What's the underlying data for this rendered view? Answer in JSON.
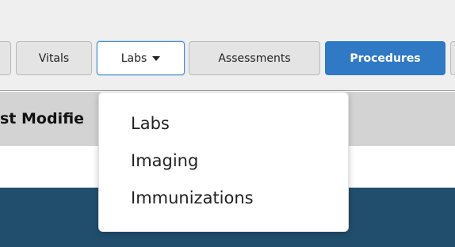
{
  "tabs": {
    "vitals": "Vitals",
    "labs": "Labs",
    "assessments": "Assessments",
    "procedures": "Procedures"
  },
  "table": {
    "column_header": "st Modifie"
  },
  "dropdown": {
    "items": [
      "Labs",
      "Imaging",
      "Immunizations"
    ]
  },
  "colors": {
    "active_tab": "#2f79c5",
    "bottom_band": "#214e6d",
    "header_bg": "#d3d3d3"
  },
  "icons": {
    "labs_caret": "caret-down-icon"
  }
}
